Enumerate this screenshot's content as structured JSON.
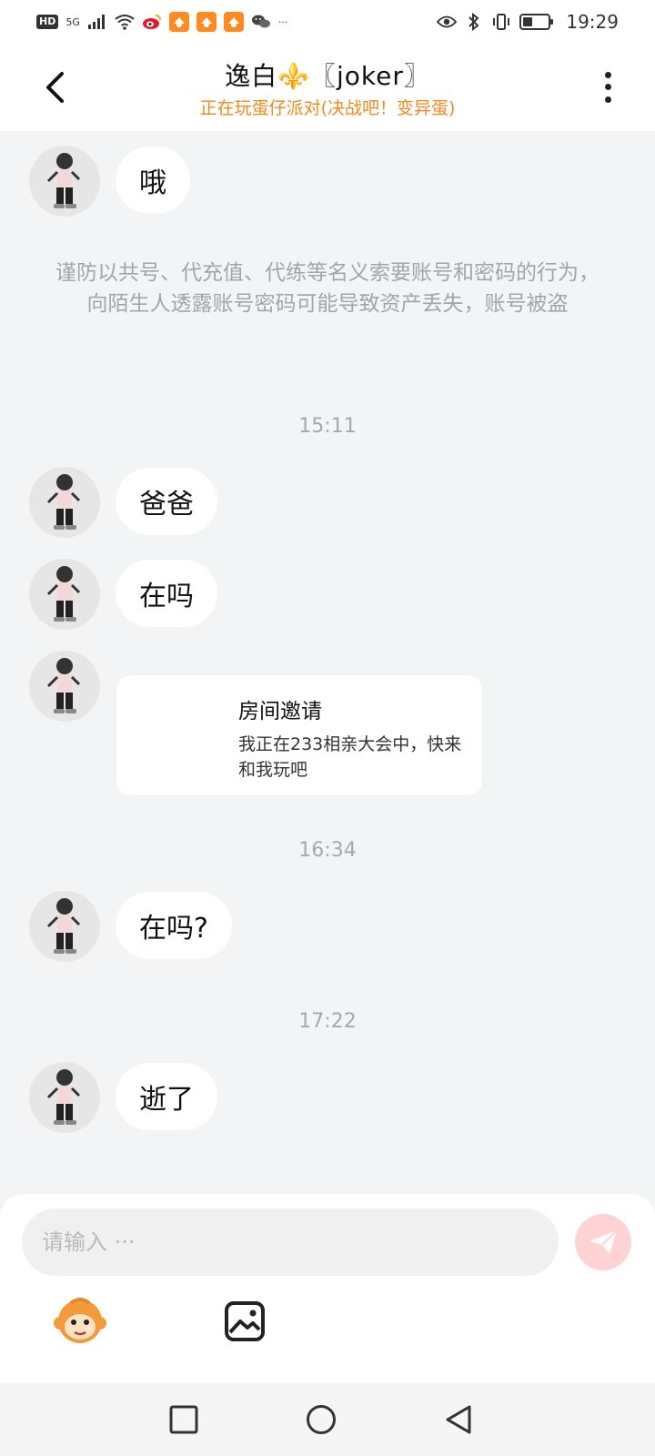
{
  "status_bar": {
    "network_badge": "HD",
    "network_type": "5G",
    "time": "19:29",
    "icons": [
      "signal-icon",
      "wifi-icon",
      "weibo-icon",
      "app-icon",
      "app-icon",
      "app-icon",
      "wechat-icon",
      "more-icon",
      "eye-icon",
      "bluetooth-icon",
      "vibrate-icon",
      "battery-icon"
    ],
    "more_dots": "···"
  },
  "header": {
    "title": "逸白⚜️〖joker〗",
    "subtitle": "正在玩蛋仔派对(决战吧！变异蛋)"
  },
  "chat": {
    "notice": "谨防以共号、代充值、代练等名义索要账号和密码的行为，向陌生人透露账号密码可能导致资产丢失，账号被盗",
    "messages": [
      {
        "text": "哦"
      },
      {
        "text": "爸爸"
      },
      {
        "text": "在吗"
      },
      {
        "text": "在吗?"
      },
      {
        "text": "逝了"
      }
    ],
    "timestamps": [
      "15:11",
      "16:34",
      "17:22"
    ],
    "invite": {
      "title": "房间邀请",
      "description": "我正在233相亲大会中，快来和我玩吧"
    }
  },
  "input": {
    "placeholder": "请输入 ···"
  },
  "colors": {
    "accent": "#f08a1e",
    "background": "#f3f4f6",
    "send_button": "#ffd3d3"
  }
}
